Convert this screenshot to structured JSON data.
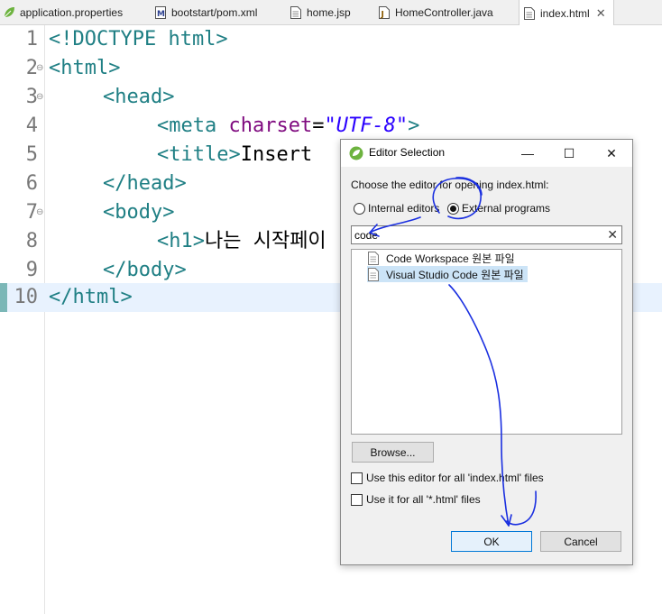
{
  "tabs": [
    {
      "label": "application.properties",
      "icon": "spring-leaf-icon"
    },
    {
      "label": "bootstart/pom.xml",
      "icon": "maven-file-icon"
    },
    {
      "label": "home.jsp",
      "icon": "jsp-file-icon"
    },
    {
      "label": "HomeController.java",
      "icon": "java-file-icon"
    },
    {
      "label": "index.html",
      "icon": "html-file-icon",
      "active": true
    }
  ],
  "editor": {
    "lines": [
      {
        "num": "1",
        "parts": [
          "<!DOCTYPE html>"
        ]
      },
      {
        "num": "2",
        "parts": [
          "<html>"
        ]
      },
      {
        "num": "3",
        "parts": [
          "<head>"
        ]
      },
      {
        "num": "4",
        "parts": [
          "<meta",
          " charset",
          "=",
          "\"UTF-8\"",
          ">"
        ]
      },
      {
        "num": "5",
        "parts": [
          "<title>",
          "Insert"
        ]
      },
      {
        "num": "6",
        "parts": [
          "</head>"
        ]
      },
      {
        "num": "7",
        "parts": [
          "<body>"
        ]
      },
      {
        "num": "8",
        "parts": [
          "<h1>",
          "나는 시작페이"
        ]
      },
      {
        "num": "9",
        "parts": [
          "</body>"
        ]
      },
      {
        "num": "10",
        "parts": [
          "</html>"
        ]
      }
    ]
  },
  "dialog": {
    "title": "Editor Selection",
    "window_controls": {
      "minimize": "—",
      "maximize": "☐",
      "close": "✕"
    },
    "prompt": "Choose the editor for opening index.html:",
    "radio_internal": "Internal editors",
    "radio_external": "External programs",
    "selected_radio": "External programs",
    "filter_value": "code",
    "clear_glyph": "✕",
    "programs": [
      {
        "label": "Code Workspace 원본 파일",
        "selected": false
      },
      {
        "label": "Visual Studio Code 원본 파일",
        "selected": true
      }
    ],
    "browse_label": "Browse...",
    "check_use_editor": "Use this editor for all 'index.html' files",
    "check_use_all": "Use it for all '*.html' files",
    "ok_label": "OK",
    "cancel_label": "Cancel"
  },
  "colors": {
    "tag": "#1f7f84",
    "attribute": "#7f0a7f",
    "attribute_value": "#2a00ff",
    "current_line": "#e8f2fe",
    "annotation_ink": "#1a2fe0",
    "selection": "#cce4f7"
  }
}
